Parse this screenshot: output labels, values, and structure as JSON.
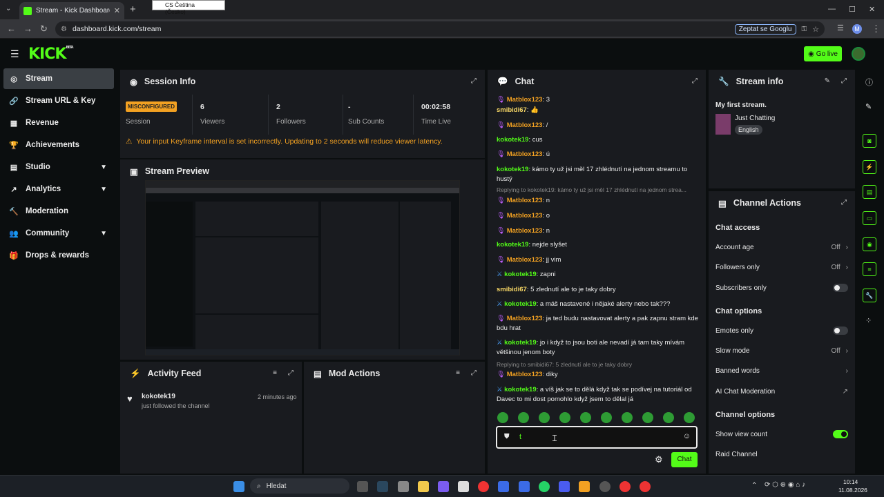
{
  "browser": {
    "tab_title": "Stream - Kick Dashboard",
    "tooltip": "CS Čeština (Česko)",
    "url": "dashboard.kick.com/stream",
    "google_btn": "Zeptat se Googlu",
    "profile": "M"
  },
  "header": {
    "logo": "KICK",
    "beta": "BETA",
    "go_live": "Go live"
  },
  "sidebar": {
    "items": [
      {
        "label": "Stream",
        "icon": "broadcast-icon"
      },
      {
        "label": "Stream URL & Key",
        "icon": "link-icon"
      },
      {
        "label": "Revenue",
        "icon": "chart-icon"
      },
      {
        "label": "Achievements",
        "icon": "trophy-icon"
      },
      {
        "label": "Studio",
        "icon": "grid-icon"
      },
      {
        "label": "Analytics",
        "icon": "analytics-icon"
      },
      {
        "label": "Moderation",
        "icon": "hammer-icon"
      },
      {
        "label": "Community",
        "icon": "users-icon"
      },
      {
        "label": "Drops & rewards",
        "icon": "gift-icon"
      }
    ]
  },
  "session": {
    "title": "Session Info",
    "status": "MISCONFIGURED",
    "status_label": "Session",
    "stats": [
      {
        "value": "6",
        "label": "Viewers"
      },
      {
        "value": "2",
        "label": "Followers"
      },
      {
        "value": "-",
        "label": "Sub Counts"
      },
      {
        "value": "00:02:58",
        "label": "Time Live"
      }
    ],
    "warning": "Your input Keyframe interval is set incorrectly. Updating to 2 seconds will reduce viewer latency."
  },
  "preview": {
    "title": "Stream Preview"
  },
  "activity": {
    "title": "Activity Feed",
    "user": "kokotek19",
    "time": "2 minutes ago",
    "text": "just followed the channel"
  },
  "mod": {
    "title": "Mod Actions"
  },
  "chat": {
    "title": "Chat",
    "messages": [
      {
        "user": "Matblox123",
        "text": "3",
        "color": "#f2a122",
        "icon": "mic"
      },
      {
        "user": "smibidi67",
        "text": "👍",
        "color": "#f7d766",
        "icon": ""
      },
      {
        "user": "Matblox123",
        "text": "/",
        "color": "#f2a122",
        "icon": "mic"
      },
      {
        "user": "kokotek19",
        "text": "cus",
        "color": "#53fc18",
        "icon": ""
      },
      {
        "user": "Matblox123",
        "text": "ú",
        "color": "#f2a122",
        "icon": "mic"
      },
      {
        "user": "kokotek19",
        "text": "kámo ty už jsi měl 17 zhlédnutí na jednom streamu to hustý",
        "color": "#53fc18",
        "icon": ""
      },
      {
        "reply": "Replying to kokotek19: kámo ty už jsi měl 17 zhlédnutí na jednom strea..."
      },
      {
        "user": "Matblox123",
        "text": "n",
        "color": "#f2a122",
        "icon": "mic"
      },
      {
        "user": "Matblox123",
        "text": "o",
        "color": "#f2a122",
        "icon": "mic"
      },
      {
        "user": "Matblox123",
        "text": "n",
        "color": "#f2a122",
        "icon": "mic"
      },
      {
        "user": "kokotek19",
        "text": "nejde slyšet",
        "color": "#53fc18",
        "icon": ""
      },
      {
        "user": "Matblox123",
        "text": "jj vim",
        "color": "#f2a122",
        "icon": "mic"
      },
      {
        "user": "kokotek19",
        "text": "zapni",
        "color": "#53fc18",
        "icon": "mod"
      },
      {
        "user": "smibidi67",
        "text": "5 zlednutí ale to je taky dobry",
        "color": "#f7d766",
        "icon": ""
      },
      {
        "user": "kokotek19",
        "text": "a máš nastavené i nějaké alerty nebo tak???",
        "color": "#53fc18",
        "icon": "mod"
      },
      {
        "user": "Matblox123",
        "text": "ja ted budu nastavovat alerty a pak zapnu stram kde bdu hrat",
        "color": "#f2a122",
        "icon": "mic"
      },
      {
        "user": "kokotek19",
        "text": "jo i když to jsou boti ale nevadí já tam taky mívám většinou jenom boty",
        "color": "#53fc18",
        "icon": "mod"
      },
      {
        "reply": "Replying to smibidi67: 5 zlednutí ale to je taky dobry"
      },
      {
        "user": "Matblox123",
        "text": "diky",
        "color": "#f2a122",
        "icon": "mic"
      },
      {
        "user": "kokotek19",
        "text": "a víš jak se to dělá když tak se podívej na tutoriál od Davec to mi dost pomohlo když jsem to dělal já",
        "color": "#53fc18",
        "icon": "mod"
      }
    ],
    "input_value": "t",
    "send": "Chat"
  },
  "stream_info": {
    "title": "Stream info",
    "stream_title": "My first stream.",
    "category": "Just Chatting",
    "language": "English"
  },
  "channel_actions": {
    "title": "Channel Actions",
    "chat_access": {
      "heading": "Chat access",
      "rows": [
        {
          "label": "Account age",
          "value": "Off"
        },
        {
          "label": "Followers only",
          "value": "Off"
        },
        {
          "label": "Subscribers only",
          "toggle": false
        }
      ]
    },
    "chat_options": {
      "heading": "Chat options",
      "rows": [
        {
          "label": "Emotes only",
          "toggle": false
        },
        {
          "label": "Slow mode",
          "value": "Off"
        },
        {
          "label": "Banned words",
          "value": ""
        },
        {
          "label": "AI Chat Moderation",
          "value": ""
        }
      ]
    },
    "channel_options": {
      "heading": "Channel options",
      "rows": [
        {
          "label": "Show view count",
          "toggle": true
        },
        {
          "label": "Raid Channel",
          "value": ""
        }
      ]
    }
  },
  "taskbar": {
    "search": "Hledat",
    "time": "10:14",
    "date": "11.08.2026"
  }
}
